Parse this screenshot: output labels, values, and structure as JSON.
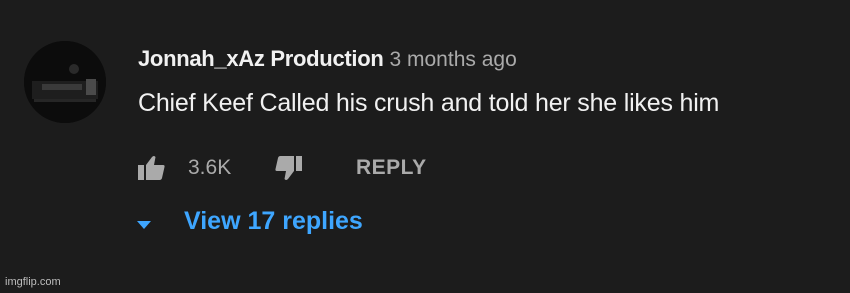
{
  "comment": {
    "author": "Jonnah_xAz Production",
    "time": "3 months ago",
    "text": "Chief Keef Called his crush and told her she likes him",
    "like_count": "3.6K",
    "reply_label": "REPLY",
    "view_replies_label": "View 17 replies"
  },
  "icons": {
    "like": "thumbs-up-icon",
    "dislike": "thumbs-down-icon",
    "expand": "chevron-down-icon"
  },
  "colors": {
    "background": "#1c1c1c",
    "text_primary": "#f1f1f1",
    "text_secondary": "#aaaaaa",
    "link": "#3ea6ff"
  },
  "watermark": "imgflip.com"
}
